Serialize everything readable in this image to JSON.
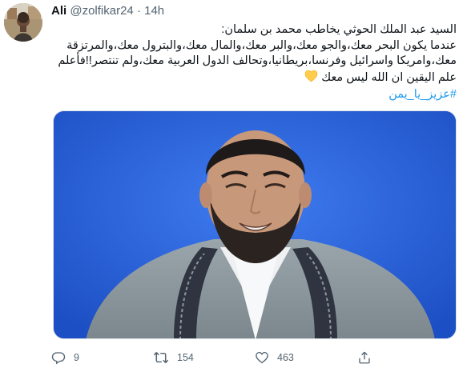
{
  "author": {
    "name": "Ali",
    "handle": "@zolfikar24",
    "separator": "·",
    "time": "14h"
  },
  "tweet": {
    "lines": [
      "السيد عبد الملك الحوثي يخاطب محمد بن سلمان:",
      "عندما يكون البحر معك،والجو معك،والبر معك،والمال معك،والبترول معك،والمرتزقة",
      "معك،وامريكا واسرائيل وفرنسا،بريطانيا،وتحالف الدول العربية معك،ولم تنتصر!!فأعلم",
      "علم اليقين ان الله ليس معك"
    ],
    "hashtag": "#عزيز_يا_يمن",
    "emoji": "yellow-heart-icon"
  },
  "actions": {
    "reply_count": "9",
    "retweet_count": "154",
    "like_count": "463"
  },
  "colors": {
    "link": "#1d9bf0",
    "muted": "#536471",
    "photo_background": "#2a5fd6"
  }
}
